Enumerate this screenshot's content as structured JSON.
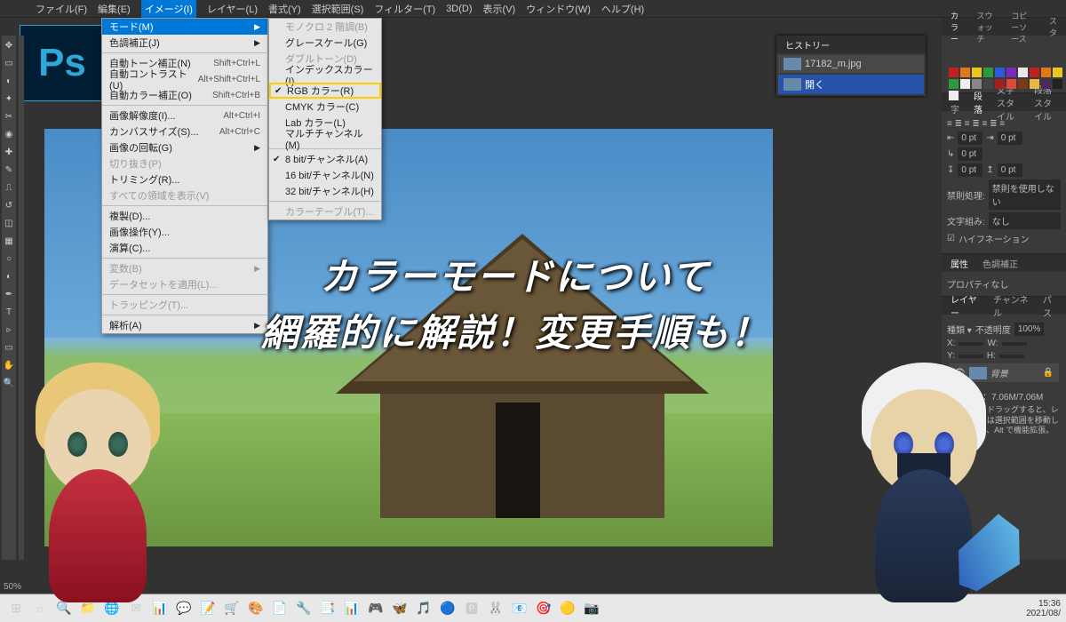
{
  "app": {
    "ps_logo": "Ps"
  },
  "menubar": [
    "ファイル(F)",
    "編集(E)",
    "イメージ(I)",
    "レイヤー(L)",
    "書式(Y)",
    "選択範囲(S)",
    "フィルター(T)",
    "3D(D)",
    "表示(V)",
    "ウィンドウ(W)",
    "ヘルプ(H)"
  ],
  "menubar_active_index": 2,
  "dropdown": {
    "items": [
      {
        "label": "モード(M)",
        "arrow": true,
        "hover": true
      },
      {
        "label": "色調補正(J)",
        "arrow": true
      },
      {
        "sep": true
      },
      {
        "label": "自動トーン補正(N)",
        "shortcut": "Shift+Ctrl+L"
      },
      {
        "label": "自動コントラスト(U)",
        "shortcut": "Alt+Shift+Ctrl+L"
      },
      {
        "label": "自動カラー補正(O)",
        "shortcut": "Shift+Ctrl+B"
      },
      {
        "sep": true
      },
      {
        "label": "画像解像度(I)...",
        "shortcut": "Alt+Ctrl+I"
      },
      {
        "label": "カンバスサイズ(S)...",
        "shortcut": "Alt+Ctrl+C"
      },
      {
        "label": "画像の回転(G)",
        "arrow": true
      },
      {
        "label": "切り抜き(P)",
        "disabled": true
      },
      {
        "label": "トリミング(R)..."
      },
      {
        "label": "すべての領域を表示(V)",
        "disabled": true
      },
      {
        "sep": true
      },
      {
        "label": "複製(D)..."
      },
      {
        "label": "画像操作(Y)..."
      },
      {
        "label": "演算(C)..."
      },
      {
        "sep": true
      },
      {
        "label": "変数(B)",
        "arrow": true,
        "disabled": true
      },
      {
        "label": "データセットを適用(L)...",
        "disabled": true
      },
      {
        "sep": true
      },
      {
        "label": "トラッピング(T)...",
        "disabled": true
      },
      {
        "sep": true
      },
      {
        "label": "解析(A)",
        "arrow": true
      }
    ]
  },
  "submenu": {
    "items": [
      {
        "label": "モノクロ 2 階調(B)",
        "disabled": true
      },
      {
        "label": "グレースケール(G)"
      },
      {
        "label": "ダブルトーン(D)",
        "disabled": true
      },
      {
        "label": "インデックスカラー(I)..."
      },
      {
        "label": "RGB カラー(R)",
        "checked": true,
        "highlighted": true
      },
      {
        "label": "CMYK カラー(C)"
      },
      {
        "label": "Lab カラー(L)"
      },
      {
        "label": "マルチチャンネル(M)"
      },
      {
        "sep": true
      },
      {
        "label": "8 bit/チャンネル(A)",
        "checked": true
      },
      {
        "label": "16 bit/チャンネル(N)"
      },
      {
        "label": "32 bit/チャンネル(H)"
      },
      {
        "sep": true
      },
      {
        "label": "カラーテーブル(T)...",
        "disabled": true
      }
    ]
  },
  "overlay": {
    "line1": "カラーモードについて",
    "line2": "網羅的に解説！変更手順も！"
  },
  "history": {
    "title": "ヒストリー",
    "rows": [
      {
        "label": "17182_m.jpg"
      },
      {
        "label": "開く",
        "selected": true
      }
    ]
  },
  "right_tabs_color": [
    "カラー",
    "スウォッチ",
    "コピーソース",
    "スタ"
  ],
  "swatches": [
    "#c02020",
    "#e07818",
    "#e8c820",
    "#2a9a3a",
    "#2a5ade",
    "#7a2ac0",
    "#e8e8e8",
    "#c02020",
    "#e07818",
    "#e8c820",
    "#2a9a3a",
    "#eee",
    "#888",
    "#444",
    "#a02020",
    "#e04838",
    "#7a3a1a",
    "#e8b840",
    "#4a2a5a",
    "#222",
    "#eee"
  ],
  "paragraph_panel": {
    "tabs": [
      "文字",
      "段落",
      "文字スタイル",
      "段落スタイル"
    ],
    "active": 1,
    "left": "0 pt",
    "right": "0 pt",
    "before": "0 pt",
    "after": "0 pt",
    "first": "0 pt",
    "kinsoku_label": "禁則処理:",
    "kinsoku_val": "禁則を使用しない",
    "moji_label": "文字組み:",
    "moji_val": "なし",
    "hyph": "ハイフネーション"
  },
  "properties_panel": {
    "tabs": [
      "属性",
      "色調補正"
    ],
    "active": 0,
    "msg": "プロパティなし"
  },
  "layers_panel": {
    "tabs": [
      "レイヤー",
      "チャンネル",
      "パス"
    ],
    "opacity_label": "不透明度",
    "opacity": "100%",
    "x": "X:",
    "y": "Y:",
    "w": "W:",
    "h": "H:",
    "file": "ファイル：7.06M/7.06M",
    "hint": "クリック＆ドラッグすると、レイヤーまたは選択範囲を移動します。Shift、Alt で機能拡張。",
    "bg_label": "背景"
  },
  "status": {
    "zoom": "50%"
  },
  "taskbar": {
    "icons": [
      "⊞",
      "○",
      "🔍",
      "📁",
      "🌐",
      "✉",
      "📊",
      "💬",
      "📝",
      "🛒",
      "🎨",
      "📄",
      "🔧",
      "📑",
      "📊",
      "🎮",
      "🦋",
      "🎵",
      "🔵",
      "🅿",
      "🐰",
      "📧",
      "🎯",
      "🟡",
      "📷"
    ],
    "clock": "15:36",
    "date": "2021/08/"
  }
}
